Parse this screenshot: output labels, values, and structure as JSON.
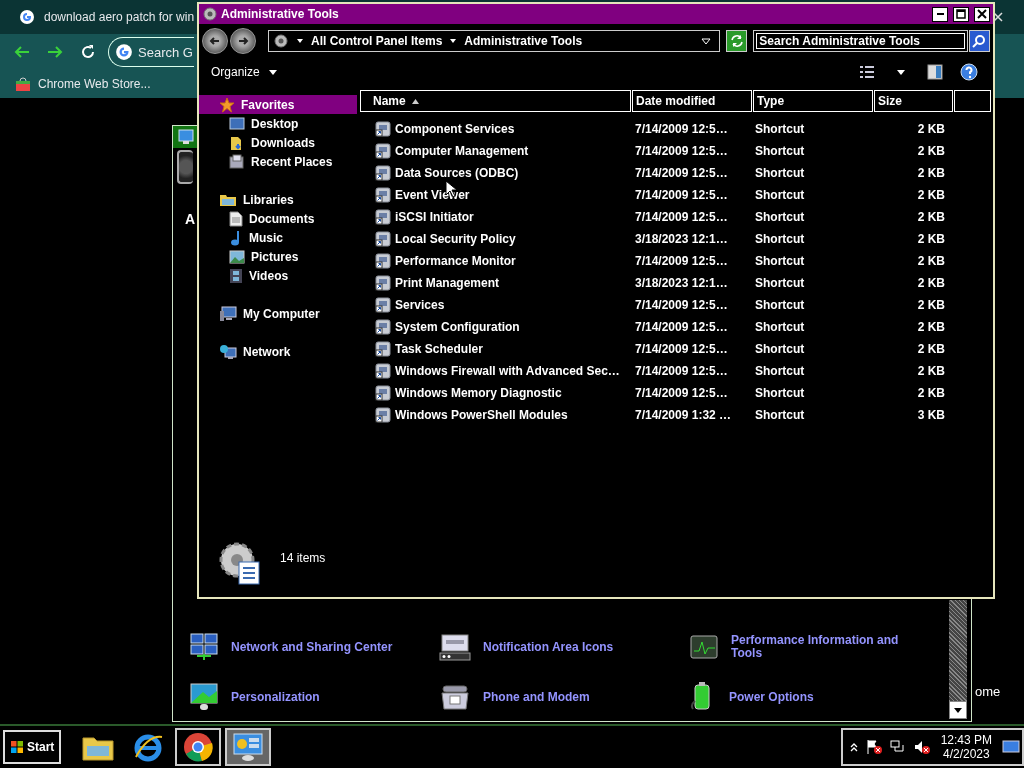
{
  "browser": {
    "tab_title": "download aero patch for win",
    "omnibox": {
      "placeholder": "Search G"
    },
    "bookmark": "Chrome Web Store...",
    "page_fragment": "ome"
  },
  "control_panel": {
    "fragment": "A",
    "items": [
      {
        "label": "Network and Sharing Center"
      },
      {
        "label": "Notification Area Icons"
      },
      {
        "label": "Performance Information and Tools"
      },
      {
        "label": "Personalization"
      },
      {
        "label": "Phone and Modem"
      },
      {
        "label": "Power Options"
      }
    ]
  },
  "explorer": {
    "title": "Administrative Tools",
    "breadcrumb": [
      "All Control Panel Items",
      "Administrative Tools"
    ],
    "search": {
      "placeholder": "Search Administrative Tools"
    },
    "organize": "Organize",
    "sidebar": [
      {
        "label": "Favorites",
        "selected": true,
        "children": [
          {
            "label": "Desktop",
            "selected": false
          },
          {
            "label": "Downloads",
            "selected": false
          },
          {
            "label": "Recent Places",
            "selected": false
          }
        ]
      },
      {
        "label": "Libraries",
        "selected": false,
        "children": [
          {
            "label": "Documents",
            "selected": false
          },
          {
            "label": "Music",
            "selected": false
          },
          {
            "label": "Pictures",
            "selected": false
          },
          {
            "label": "Videos",
            "selected": false
          }
        ]
      },
      {
        "label": "My Computer",
        "selected": false
      },
      {
        "label": "Network",
        "selected": false
      }
    ],
    "columns": [
      {
        "label": "Name",
        "sorted": true
      },
      {
        "label": "Date modified",
        "sorted": false
      },
      {
        "label": "Type",
        "sorted": false
      },
      {
        "label": "Size",
        "sorted": false
      }
    ],
    "rows": [
      {
        "name": "Component Services",
        "date": "7/14/2009 12:5…",
        "type": "Shortcut",
        "size": "2 KB"
      },
      {
        "name": "Computer Management",
        "date": "7/14/2009 12:5…",
        "type": "Shortcut",
        "size": "2 KB"
      },
      {
        "name": "Data Sources (ODBC)",
        "date": "7/14/2009 12:5…",
        "type": "Shortcut",
        "size": "2 KB"
      },
      {
        "name": "Event Viewer",
        "date": "7/14/2009 12:5…",
        "type": "Shortcut",
        "size": "2 KB"
      },
      {
        "name": "iSCSI Initiator",
        "date": "7/14/2009 12:5…",
        "type": "Shortcut",
        "size": "2 KB"
      },
      {
        "name": "Local Security Policy",
        "date": "3/18/2023 12:1…",
        "type": "Shortcut",
        "size": "2 KB"
      },
      {
        "name": "Performance Monitor",
        "date": "7/14/2009 12:5…",
        "type": "Shortcut",
        "size": "2 KB"
      },
      {
        "name": "Print Management",
        "date": "3/18/2023 12:1…",
        "type": "Shortcut",
        "size": "2 KB"
      },
      {
        "name": "Services",
        "date": "7/14/2009 12:5…",
        "type": "Shortcut",
        "size": "2 KB"
      },
      {
        "name": "System Configuration",
        "date": "7/14/2009 12:5…",
        "type": "Shortcut",
        "size": "2 KB"
      },
      {
        "name": "Task Scheduler",
        "date": "7/14/2009 12:5…",
        "type": "Shortcut",
        "size": "2 KB"
      },
      {
        "name": "Windows Firewall with Advanced Sec…",
        "date": "7/14/2009 12:5…",
        "type": "Shortcut",
        "size": "2 KB"
      },
      {
        "name": "Windows Memory Diagnostic",
        "date": "7/14/2009 12:5…",
        "type": "Shortcut",
        "size": "2 KB"
      },
      {
        "name": "Windows PowerShell Modules",
        "date": "7/14/2009 1:32 …",
        "type": "Shortcut",
        "size": "3 KB"
      }
    ],
    "status": "14 items"
  },
  "taskbar": {
    "start": "Start",
    "apps": [
      {
        "running": false,
        "active": false
      },
      {
        "running": false,
        "active": false
      },
      {
        "running": true,
        "active": false
      },
      {
        "running": true,
        "active": true
      }
    ],
    "clock": {
      "time": "12:43 PM",
      "date": "4/2/2023"
    }
  }
}
